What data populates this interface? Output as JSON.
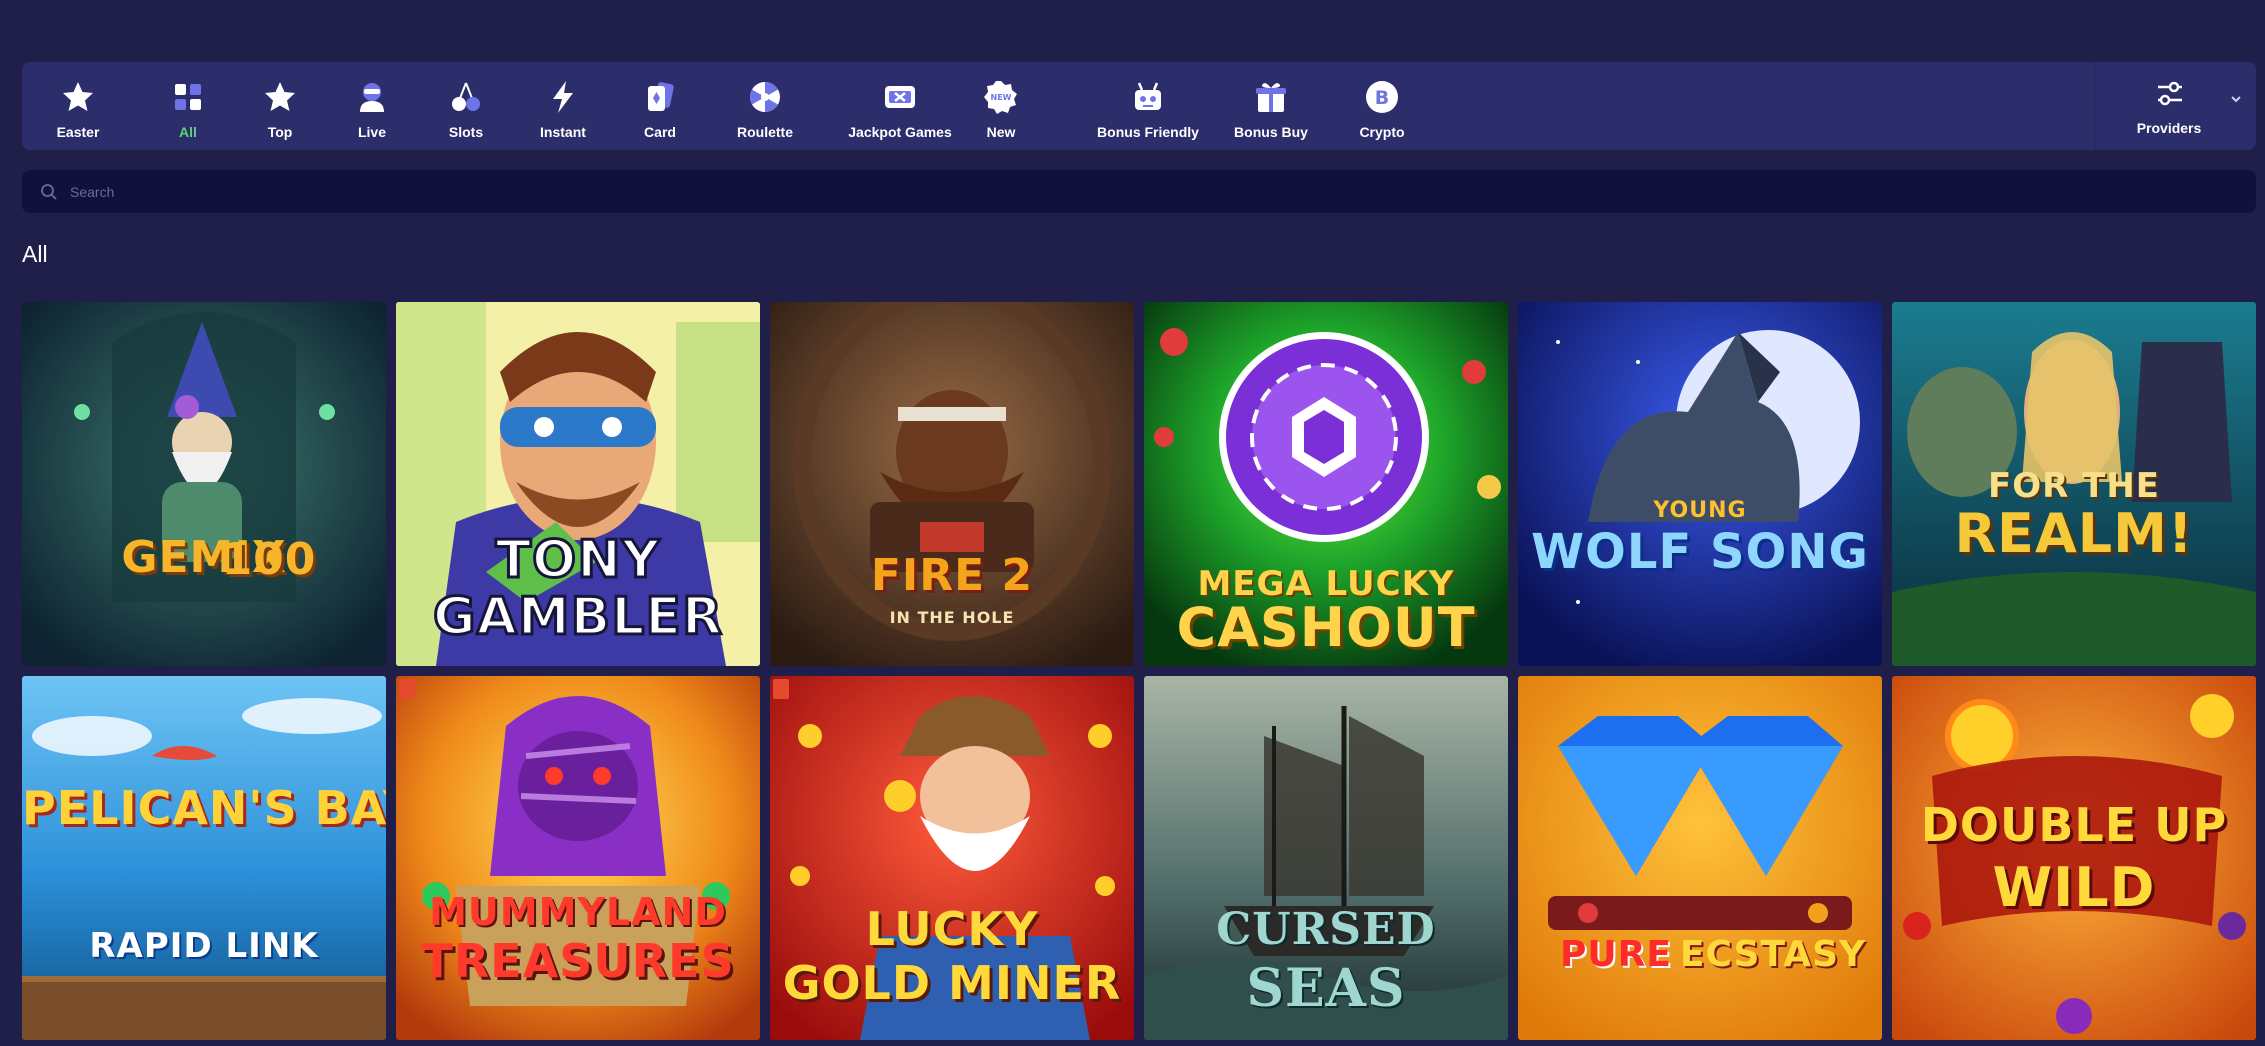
{
  "categories": [
    {
      "label": "Easter",
      "icon": "star-icon",
      "active": false
    },
    {
      "label": "All",
      "icon": "grid-icon",
      "active": true
    },
    {
      "label": "Top",
      "icon": "star-icon",
      "active": false
    },
    {
      "label": "Live",
      "icon": "dealer-icon",
      "active": false
    },
    {
      "label": "Slots",
      "icon": "cherry-icon",
      "active": false
    },
    {
      "label": "Instant",
      "icon": "lightning-icon",
      "active": false
    },
    {
      "label": "Card",
      "icon": "cards-icon",
      "active": false
    },
    {
      "label": "Roulette",
      "icon": "roulette-icon",
      "active": false
    },
    {
      "label": "Jackpot Games",
      "icon": "jackpot-icon",
      "active": false
    },
    {
      "label": "New",
      "icon": "new-badge-icon",
      "active": false
    },
    {
      "label": "Bonus Friendly",
      "icon": "bonus-robot-icon",
      "active": false
    },
    {
      "label": "Bonus Buy",
      "icon": "gift-icon",
      "active": false
    },
    {
      "label": "Crypto",
      "icon": "bitcoin-icon",
      "active": false
    }
  ],
  "providers": {
    "label": "Providers",
    "icon": "sliders-icon"
  },
  "search": {
    "placeholder": "Search"
  },
  "section_title": "All",
  "games": [
    {
      "line1": "GEMIX",
      "line2": "100",
      "highlighted": false
    },
    {
      "line1": "TONY",
      "line2": "GAMBLER",
      "highlighted": true
    },
    {
      "line1": "FIRE 2",
      "line2": "IN THE HOLE",
      "highlighted": false
    },
    {
      "line1": "MEGA LUCKY",
      "line2": "CASHOUT",
      "highlighted": false
    },
    {
      "line1": "YOUNG",
      "line2": "WOLF SONG",
      "highlighted": false
    },
    {
      "line1": "FOR THE",
      "line2": "REALM!",
      "highlighted": false
    },
    {
      "line1": "PELICAN'S BAY",
      "line2": "RAPID LINK",
      "highlighted": false
    },
    {
      "line1": "MUMMYLAND",
      "line2": "TREASURES",
      "highlighted": false
    },
    {
      "line1": "LUCKY",
      "line2": "GOLD MINER",
      "highlighted": false
    },
    {
      "line1": "CURSED",
      "line2": "SEAS",
      "highlighted": false
    },
    {
      "line1": "PURE",
      "line2": "ECSTASY",
      "highlighted": false
    },
    {
      "line1": "DOUBLE UP",
      "line2": "WILD",
      "highlighted": false
    }
  ],
  "colors": {
    "background": "#1f1f4a",
    "bar": "#2c2d6b",
    "search": "#12113b",
    "active": "#62d27a",
    "icon_accent": "#6e73e6"
  }
}
